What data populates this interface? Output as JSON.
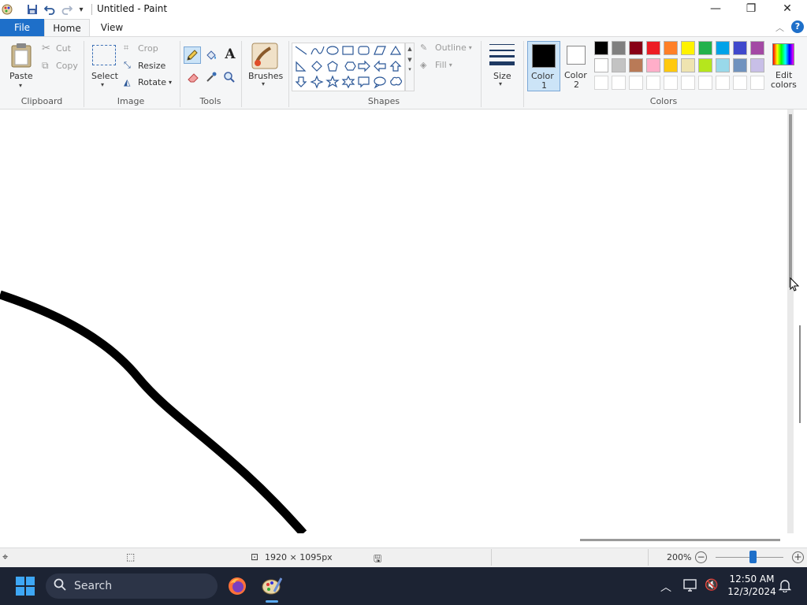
{
  "window": {
    "title": "Untitled - Paint",
    "minimize_glyph": "—",
    "maximize_glyph": "❐",
    "close_glyph": "✕"
  },
  "tabs": [
    {
      "label": "File"
    },
    {
      "label": "Home"
    },
    {
      "label": "View"
    }
  ],
  "ribbon": {
    "clipboard": {
      "paste": "Paste",
      "cut": "Cut",
      "copy": "Copy",
      "group": "Clipboard"
    },
    "image": {
      "select": "Select",
      "crop": "Crop",
      "resize": "Resize",
      "rotate": "Rotate",
      "group": "Image"
    },
    "tools": {
      "group": "Tools"
    },
    "brushes": {
      "label": "Brushes"
    },
    "shapes": {
      "outline": "Outline",
      "fill": "Fill",
      "group": "Shapes"
    },
    "size": {
      "label": "Size"
    },
    "color1": {
      "label1": "Color",
      "label2": "1"
    },
    "color2": {
      "label1": "Color",
      "label2": "2"
    },
    "edit_colors": {
      "label1": "Edit",
      "label2": "colors"
    },
    "colors_group": "Colors",
    "palette_row1": [
      "#000000",
      "#7f7f7f",
      "#880015",
      "#ed1c24",
      "#ff7f27",
      "#fff200",
      "#22b14c",
      "#00a2e8",
      "#3f48cc",
      "#a349a4"
    ],
    "palette_row2": [
      "#ffffff",
      "#c3c3c3",
      "#b97a57",
      "#ffaec9",
      "#ffc90e",
      "#efe4b0",
      "#b5e61d",
      "#99d9ea",
      "#7092be",
      "#c8bfe7"
    ]
  },
  "status": {
    "dimensions": "1920 × 1095px",
    "zoom": "200%"
  },
  "taskbar": {
    "search_placeholder": "Search",
    "time": "12:50 AM",
    "date": "12/3/2024"
  }
}
